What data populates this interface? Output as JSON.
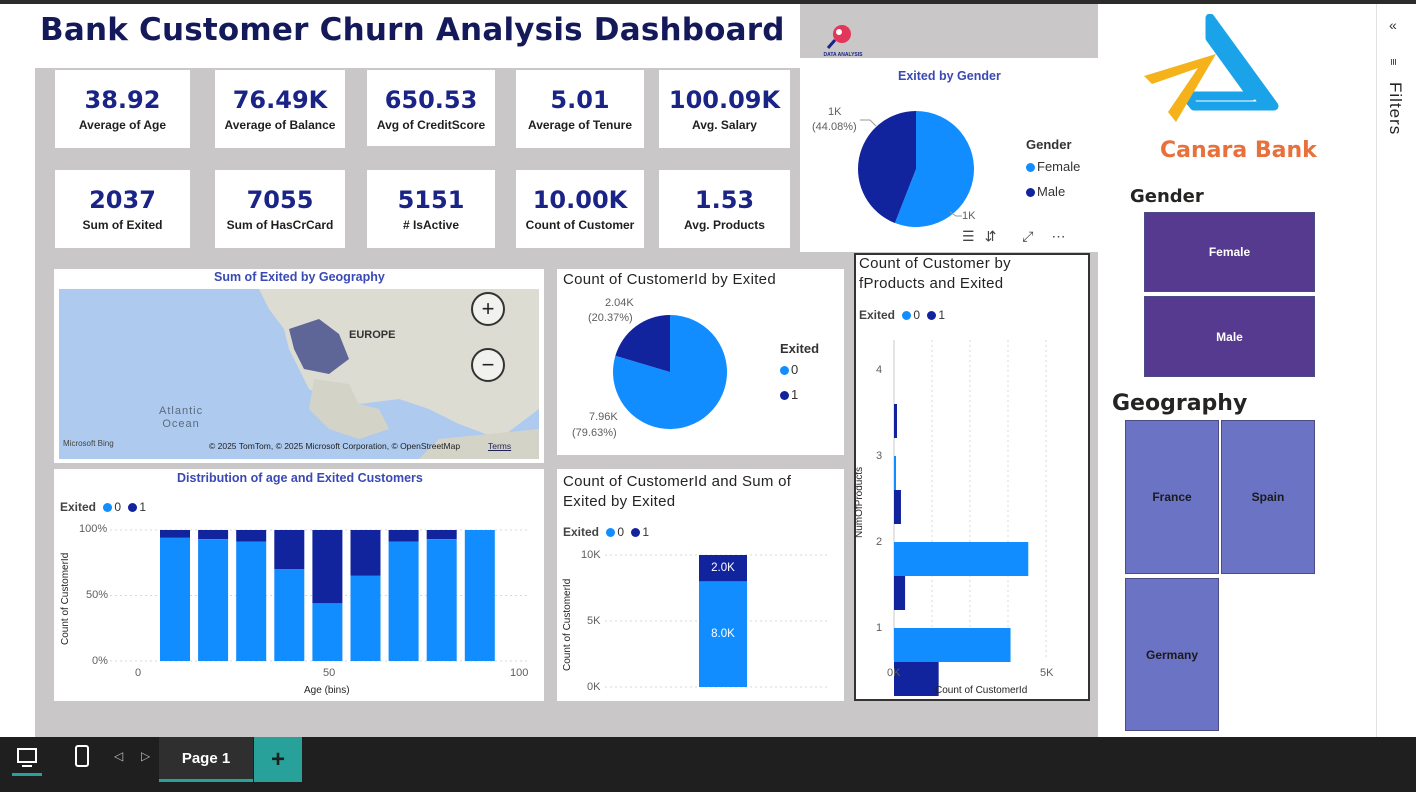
{
  "title": "Bank Customer Churn Analysis Dashboard",
  "logo_text": "DATA ANALYSIS",
  "kpis": [
    {
      "value": "38.92",
      "label": "Average of Age"
    },
    {
      "value": "76.49K",
      "label": "Average of Balance"
    },
    {
      "value": "650.53",
      "label": "Avg of CreditScore"
    },
    {
      "value": "5.01",
      "label": "Average of Tenure"
    },
    {
      "value": "100.09K",
      "label": "Avg. Salary"
    },
    {
      "value": "2037",
      "label": "Sum of Exited"
    },
    {
      "value": "7055",
      "label": "Sum of HasCrCard"
    },
    {
      "value": "5151",
      "label": "# IsActive"
    },
    {
      "value": "10.00K",
      "label": "Count of Customer"
    },
    {
      "value": "1.53",
      "label": "Avg. Products"
    }
  ],
  "colors": {
    "series0": "#118dff",
    "series1": "#12239e",
    "title_navy": "#14195a",
    "accent_orange": "#e8703a",
    "tile_purple": "#553a8f",
    "tile_blue": "#6b74c4"
  },
  "exited_by_gender": {
    "title": "Exited by Gender",
    "legend_title": "Gender",
    "legend": [
      "Female",
      "Male"
    ],
    "labels": {
      "male_value": "1K",
      "male_pct": "(44.08%)",
      "female_value": "1K"
    }
  },
  "geo_map": {
    "title": "Sum of Exited by Geography",
    "labels": {
      "europe": "EUROPE",
      "ocean": "Atlantic\nOcean"
    },
    "attribution": "© 2025 TomTom, © 2025 Microsoft Corporation, © OpenStreetMap",
    "terms": "Terms",
    "bing": "Microsoft Bing",
    "zoom_in": "+",
    "zoom_out": "−"
  },
  "count_by_exited": {
    "title": "Count of CustomerId by Exited",
    "legend_title": "Exited",
    "legend": [
      "0",
      "1"
    ],
    "labels": {
      "v1": "2.04K",
      "p1": "(20.37%)",
      "v0": "7.96K",
      "p0": "(79.63%)"
    }
  },
  "products_chart": {
    "title": "Count of Customer by fProducts and Exited",
    "legend_title": "Exited",
    "legend": [
      "0",
      "1"
    ],
    "ylabel": "NumOfProducts",
    "xlabel": "Count of CustomerId",
    "xticks": [
      "0K",
      "5K"
    ]
  },
  "age_chart": {
    "title": "Distribution of age and Exited Customers",
    "legend_title": "Exited",
    "legend": [
      "0",
      "1"
    ],
    "ylabel": "Count of CustomerId",
    "xlabel": "Age (bins)",
    "yticks": [
      "100%",
      "50%",
      "0%"
    ],
    "xticks": [
      "0",
      "50",
      "100"
    ]
  },
  "sum_chart": {
    "title": "Count of CustomerId and Sum of Exited by Exited",
    "legend_title": "Exited",
    "legend": [
      "0",
      "1"
    ],
    "ylabel": "Count of CustomerId",
    "yticks": [
      "10K",
      "5K",
      "0K"
    ],
    "top_label": "2.0K",
    "bottom_label": "8.0K"
  },
  "chart_data": [
    {
      "type": "pie",
      "title": "Exited by Gender",
      "categories": [
        "Female",
        "Male"
      ],
      "values": [
        55.92,
        44.08
      ]
    },
    {
      "type": "pie",
      "title": "Count of CustomerId by Exited",
      "categories": [
        "0",
        "1"
      ],
      "values": [
        7960,
        2040
      ]
    },
    {
      "type": "bar",
      "title": "Distribution of age and Exited Customers",
      "categories": [
        "10",
        "20",
        "30",
        "40",
        "50",
        "60",
        "70",
        "80",
        "90"
      ],
      "xlabel": "Age (bins)",
      "ylabel": "Count of CustomerId",
      "ylim": [
        0,
        100
      ],
      "series": [
        {
          "name": "0",
          "values": [
            94,
            93,
            91,
            70,
            44,
            65,
            91,
            93,
            100
          ]
        },
        {
          "name": "1",
          "values": [
            6,
            7,
            9,
            30,
            56,
            35,
            9,
            7,
            0
          ]
        }
      ]
    },
    {
      "type": "bar",
      "title": "Count of CustomerId and Sum of Exited by Exited",
      "categories": [
        "Exited"
      ],
      "ylabel": "Count of CustomerId",
      "ylim": [
        0,
        10000
      ],
      "series": [
        {
          "name": "0",
          "values": [
            8000
          ]
        },
        {
          "name": "1",
          "values": [
            2000
          ]
        }
      ]
    },
    {
      "type": "bar",
      "title": "Count of Customer by fProducts and Exited",
      "categories": [
        "4",
        "3",
        "2",
        "1"
      ],
      "xlabel": "Count of CustomerId",
      "ylabel": "NumOfProducts",
      "xlim": [
        0,
        6000
      ],
      "series": [
        {
          "name": "0",
          "values": [
            0,
            50,
            4240,
            3680
          ]
        },
        {
          "name": "1",
          "values": [
            60,
            220,
            350,
            1410
          ]
        }
      ]
    }
  ],
  "right": {
    "bank_name": "Canara Bank",
    "gender_heading": "Gender",
    "gender_tiles": [
      "Female",
      "Male"
    ],
    "geo_heading": "Geography",
    "geo_tiles": [
      "France",
      "Spain",
      "Germany"
    ]
  },
  "filters_label": "Filters",
  "page_tab": "Page 1",
  "add_page": "+"
}
